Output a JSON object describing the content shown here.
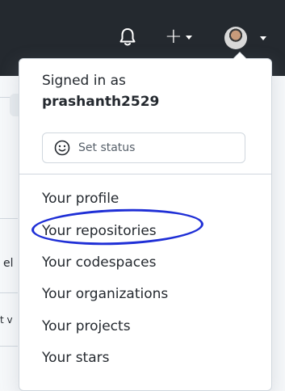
{
  "header": {
    "icons": [
      "bell-icon",
      "plus-icon",
      "avatar"
    ]
  },
  "background_fragments": {
    "frag1": "el",
    "frag2": "t v"
  },
  "account_menu": {
    "signed_in_label": "Signed in as",
    "username": "prashanth2529",
    "set_status_label": "Set status",
    "items": [
      {
        "label": "Your profile"
      },
      {
        "label": "Your repositories"
      },
      {
        "label": "Your codespaces"
      },
      {
        "label": "Your organizations"
      },
      {
        "label": "Your projects"
      },
      {
        "label": "Your stars"
      }
    ]
  },
  "annotation": {
    "highlight_color": "#1f2fd6",
    "highlighted_item": "Your repositories"
  },
  "colors": {
    "header_bg": "#24292f",
    "menu_bg": "#ffffff",
    "border": "#d0d7de"
  }
}
